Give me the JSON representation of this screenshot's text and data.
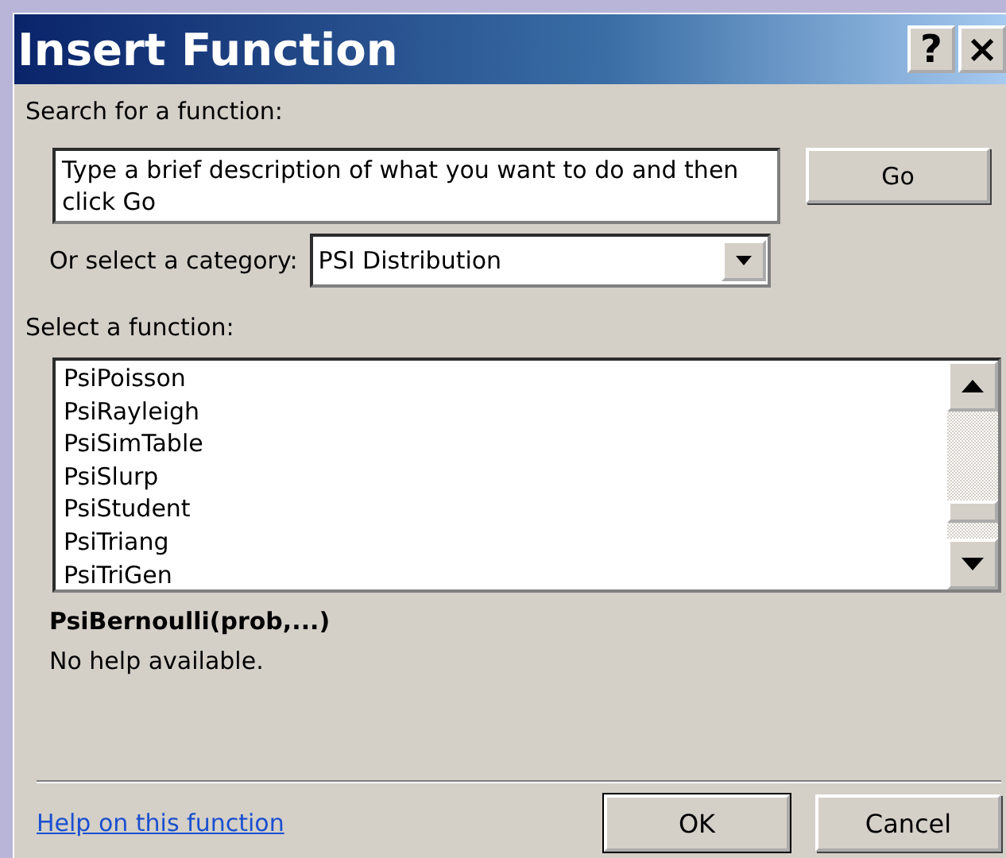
{
  "window": {
    "title": "Insert Function",
    "title_buttons": [
      "?",
      "×"
    ]
  },
  "search": {
    "label": "Search for a function:",
    "value": "Type a brief description of what you want to do and then click Go",
    "button": "Go"
  },
  "category": {
    "label": "Or select a category:",
    "value": "PSI Distribution"
  },
  "functions": {
    "label": "Select a function:",
    "items": [
      {
        "name": "PsiPoisson",
        "selected": false
      },
      {
        "name": "PsiRayleigh",
        "selected": false
      },
      {
        "name": "PsiSimTable",
        "selected": false
      },
      {
        "name": "PsiSlurp",
        "selected": false
      },
      {
        "name": "PsiStudent",
        "selected": false
      },
      {
        "name": "PsiTriang",
        "selected": false
      },
      {
        "name": "PsiTriGen",
        "selected": false
      }
    ]
  },
  "signature": "PsiBernoulli(prob,...)",
  "description": "No help available.",
  "help_link": "Help on this function",
  "buttons": [
    "OK",
    "Cancel"
  ]
}
